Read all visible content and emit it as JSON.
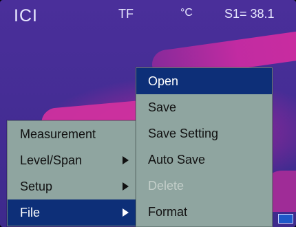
{
  "status_bar": {
    "brand": "ICI",
    "mode": "TF",
    "unit": "°C",
    "spot_reading": "S1= 38.1"
  },
  "main_menu": {
    "items": [
      {
        "label": "Measurement",
        "selected": false,
        "has_submenu": false
      },
      {
        "label": "Level/Span",
        "selected": false,
        "has_submenu": true
      },
      {
        "label": "Setup",
        "selected": false,
        "has_submenu": true
      },
      {
        "label": "File",
        "selected": true,
        "has_submenu": true
      }
    ]
  },
  "file_menu": {
    "items": [
      {
        "label": "Open",
        "selected": true,
        "enabled": true
      },
      {
        "label": "Save",
        "selected": false,
        "enabled": true
      },
      {
        "label": "Save Setting",
        "selected": false,
        "enabled": true
      },
      {
        "label": "Auto Save",
        "selected": false,
        "enabled": true
      },
      {
        "label": "Delete",
        "selected": false,
        "enabled": false
      },
      {
        "label": "Format",
        "selected": false,
        "enabled": true
      }
    ]
  },
  "colors": {
    "menu_bg": "#8fa5a0",
    "selection_bg": "#0d2f78",
    "thermal_bg": "#452d95",
    "thermal_hot": "#d0309e",
    "indicator": "#1f58c8"
  }
}
